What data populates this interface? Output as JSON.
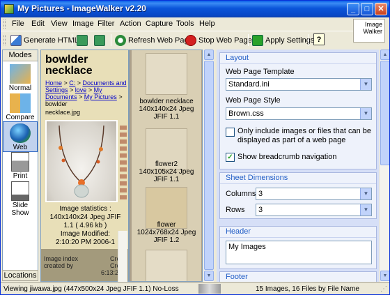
{
  "window": {
    "title": "My Pictures - ImageWalker v2.20"
  },
  "menu": {
    "items": [
      "File",
      "Edit",
      "View",
      "Image",
      "Filter",
      "Action",
      "Capture",
      "Tools",
      "Help"
    ]
  },
  "brand": {
    "line1": "Image",
    "line2": "Walker"
  },
  "toolbar": {
    "generate_html": "Generate HTML",
    "refresh_web_page": "Refresh Web Page",
    "stop_web_page": "Stop Web Page",
    "apply_settings": "Apply Settings",
    "help": "?"
  },
  "modes": {
    "header": "Modes",
    "items": [
      "Normal",
      "Compare",
      "Web",
      "Print",
      "Slide Show"
    ],
    "locations": "Locations"
  },
  "info": {
    "title": "bowlder necklace",
    "breadcrumb": [
      "Home",
      "C:",
      "Documents and Settings",
      "love",
      "My Documents",
      "My Pictures",
      "bowlder"
    ],
    "filename": "necklace.jpg",
    "stats_title": "Image statistics :",
    "stats_line1": "140x140x24 Jpeg JFIF",
    "stats_line2": "1.1 ( 4.96 kb )",
    "modified_label": "Image Modified:",
    "modified_value": "2:10:20 PM 2006-1",
    "extra_line1": "Image index",
    "extra_line2": "created by",
    "extra_right1": "Cre",
    "extra_right2": "Cre",
    "extra_right3": "6:13:2"
  },
  "thumbnails": [
    {
      "name": "bowlder necklace",
      "meta": "140x140x24 Jpeg",
      "fmt": "JFIF 1.1"
    },
    {
      "name": "flower2",
      "meta": "140x105x24 Jpeg",
      "fmt": "JFIF 1.1"
    },
    {
      "name": "flower",
      "meta": "1024x768x24 Jpeg",
      "fmt": "JFIF 1.2"
    }
  ],
  "settings": {
    "layout": {
      "header": "Layout",
      "template_label": "Web Page Template",
      "template_value": "Standard.ini",
      "style_label": "Web Page Style",
      "style_value": "Brown.css",
      "only_include_label": "Only include images or files that can be displayed as part of a web page",
      "only_include_checked": false,
      "show_breadcrumb_label": "Show breadcrumb navigation",
      "show_breadcrumb_checked": true
    },
    "sheet": {
      "header": "Sheet Dimensions",
      "columns_label": "Columns",
      "columns_value": "3",
      "rows_label": "Rows",
      "rows_value": "3"
    },
    "header_group": {
      "header": "Header",
      "value": "My Images"
    },
    "footer_group": {
      "header": "Footer"
    }
  },
  "status": {
    "left": "Viewing jiwawa.jpg (447x500x24 Jpeg JFIF 1.1) No-Loss",
    "right": "15 Images, 16 Files by File Name"
  }
}
